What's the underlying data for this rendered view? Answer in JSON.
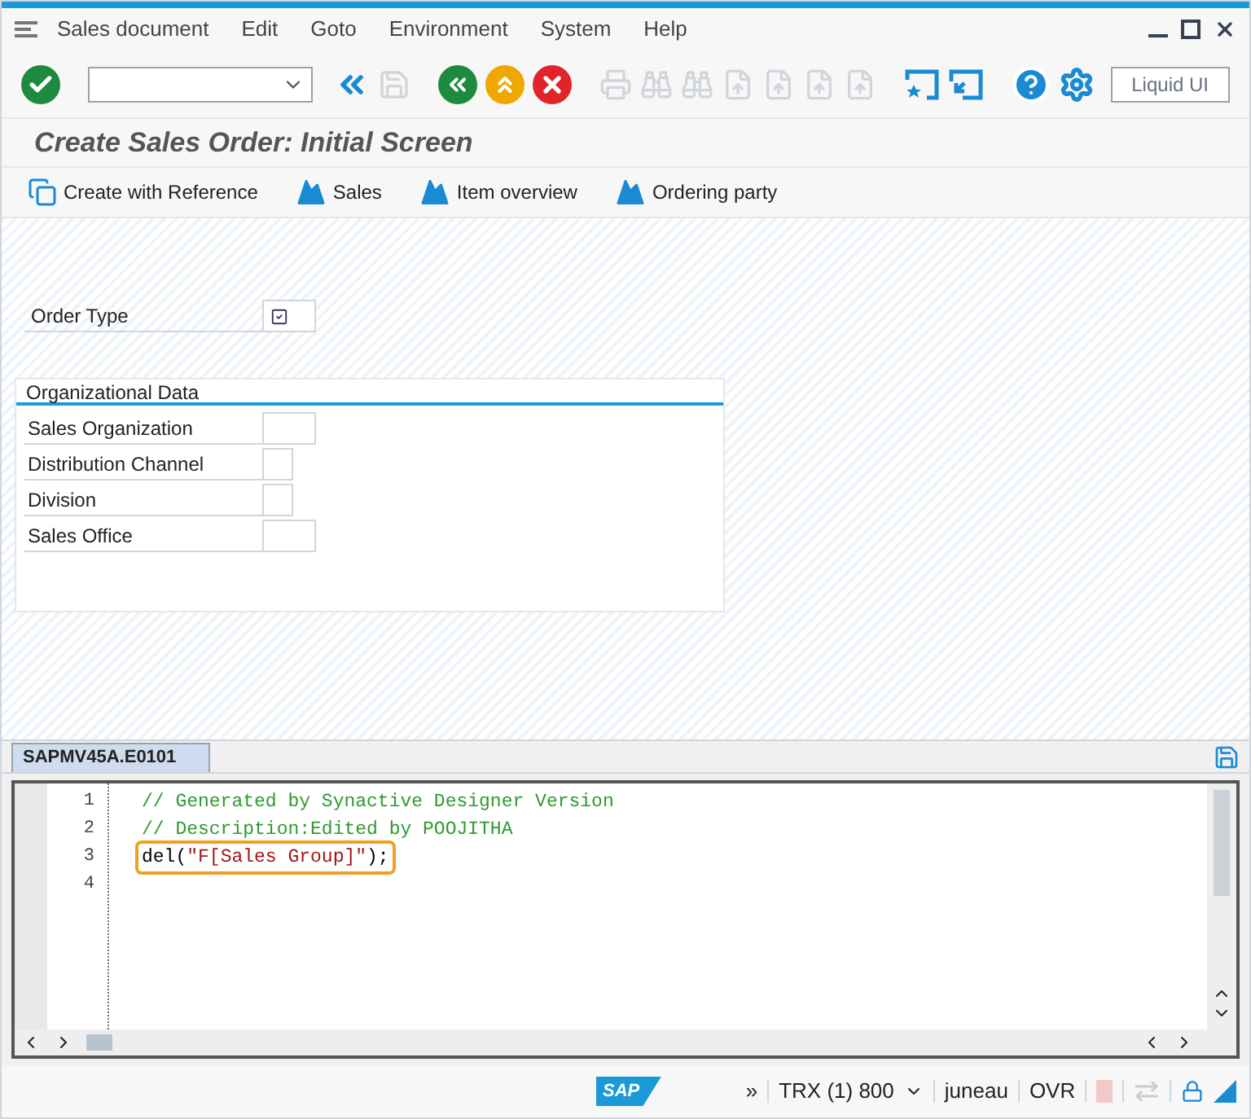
{
  "menu": [
    "Sales document",
    "Edit",
    "Goto",
    "Environment",
    "System",
    "Help"
  ],
  "toolbar": {
    "liquid_button": "Liquid UI",
    "icons": [
      {
        "kind": "enter",
        "disabled": false
      },
      {
        "kind": "field",
        "disabled": false
      },
      {
        "kind": "dbl",
        "disabled": false
      },
      {
        "kind": "save",
        "disabled": true
      },
      {
        "kind": "back",
        "disabled": false
      },
      {
        "kind": "exit",
        "disabled": false
      },
      {
        "kind": "cancel",
        "disabled": false
      },
      {
        "kind": "print",
        "disabled": true
      },
      {
        "kind": "find",
        "disabled": true
      },
      {
        "kind": "findnext",
        "disabled": true
      },
      {
        "kind": "page",
        "disabled": true
      },
      {
        "kind": "page",
        "disabled": true
      },
      {
        "kind": "page",
        "disabled": true
      },
      {
        "kind": "page",
        "disabled": true
      },
      {
        "kind": "session",
        "disabled": false
      },
      {
        "kind": "shortcut",
        "disabled": false
      },
      {
        "kind": "help",
        "disabled": false
      },
      {
        "kind": "gear",
        "disabled": false
      }
    ]
  },
  "title": "Create Sales Order: Initial Screen",
  "app_toolbar": [
    {
      "kind": "copy",
      "label": "Create with Reference"
    },
    {
      "kind": "mountain",
      "label": "Sales"
    },
    {
      "kind": "mountain",
      "label": "Item overview"
    },
    {
      "kind": "mountain",
      "label": "Ordering party"
    }
  ],
  "order_type": {
    "label": "Order Type",
    "has_f4": true
  },
  "org_data": {
    "title": "Organizational Data",
    "fields": [
      {
        "label": "Sales Organization",
        "wide": true
      },
      {
        "label": "Distribution Channel",
        "wide": false
      },
      {
        "label": "Division",
        "wide": false
      },
      {
        "label": "Sales Office",
        "wide": true
      }
    ]
  },
  "editor": {
    "tab": "SAPMV45A.E0101",
    "lines": [
      {
        "number": "1",
        "highlighted": false,
        "tokens": [
          {
            "kind": "comment",
            "text": "// Generated by Synactive Designer Version"
          }
        ]
      },
      {
        "number": "2",
        "highlighted": false,
        "tokens": [
          {
            "kind": "comment",
            "text": "// Description:Edited by POOJITHA"
          }
        ]
      },
      {
        "number": "3",
        "highlighted": true,
        "tokens": [
          {
            "kind": "plain",
            "text": "del("
          },
          {
            "kind": "string",
            "text": "\"F[Sales Group]\""
          },
          {
            "kind": "plain",
            "text": ");"
          }
        ]
      },
      {
        "number": "4",
        "highlighted": false
      }
    ]
  },
  "status_bar": {
    "logo": "SAP",
    "expand": "»",
    "system": "TRX (1) 800",
    "user": "juneau",
    "mode": "OVR"
  }
}
